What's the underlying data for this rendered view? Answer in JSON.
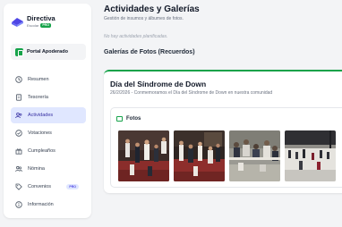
{
  "sidebar": {
    "logo": {
      "title": "Directiva",
      "subtitle": "Escolar",
      "badge": "PRO"
    },
    "portal_label": "Portal Apoderado",
    "items": [
      {
        "label": "Resumen",
        "icon": "clock-icon",
        "active": false
      },
      {
        "label": "Tesorería",
        "icon": "document-icon",
        "active": false
      },
      {
        "label": "Actividades",
        "icon": "users-icon",
        "active": true
      },
      {
        "label": "Votaciones",
        "icon": "check-circle-icon",
        "active": false
      },
      {
        "label": "Cumpleaños",
        "icon": "gift-icon",
        "active": false
      },
      {
        "label": "Nómina",
        "icon": "people-icon",
        "active": false
      },
      {
        "label": "Convenios",
        "icon": "tag-icon",
        "active": false,
        "badge": "PRO"
      },
      {
        "label": "Información",
        "icon": "info-icon",
        "active": false
      }
    ],
    "accent_color": "#16a34a",
    "active_color": "#3730a3"
  },
  "main": {
    "title": "Actividades y Galerías",
    "subtitle": "Gestión de insumos y álbumes de fotos.",
    "empty_activities": "No hay actividades planificadas.",
    "gallery_section_title": "Galerías de Fotos (Recuerdos)",
    "gallery": {
      "title": "Día del Síndrome de Down",
      "meta": "26/2/2026 - Conmemoramos el Día del Síndrome de Down en nuestra comunidad",
      "photos_label": "Fotos",
      "photos": [
        {
          "icon": "photo-dancing-students"
        },
        {
          "icon": "photo-students-dance-floor"
        },
        {
          "icon": "photo-group-outdoors"
        },
        {
          "icon": "photo-schoolyard"
        }
      ]
    }
  }
}
